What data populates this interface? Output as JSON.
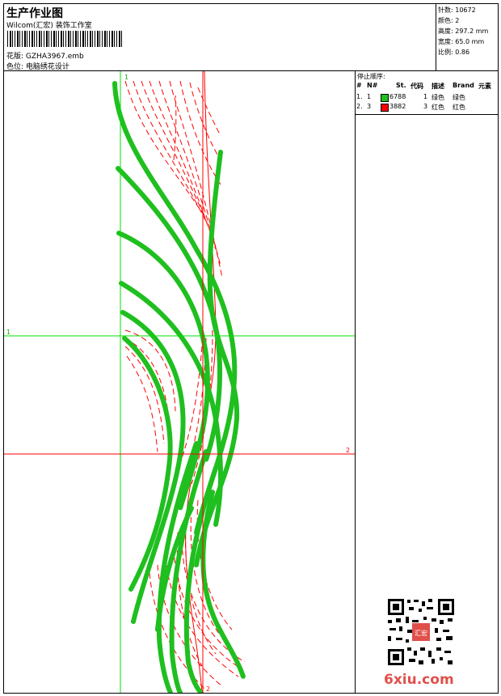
{
  "header": {
    "title": "生产作业图",
    "subtitle": "Wilcom(汇宏) 装饰工作室",
    "design_label": "花版:",
    "design_file": "GZHA3967.emb",
    "color_label": "色位:",
    "color_value": "电脑绣花设计"
  },
  "stats": [
    {
      "label": "针数:",
      "value": "10672"
    },
    {
      "label": "颜色:",
      "value": "2"
    },
    {
      "label": "高度:",
      "value": "297.2 mm"
    },
    {
      "label": "宽度:",
      "value": "65.0 mm"
    },
    {
      "label": "比例:",
      "value": "0.86"
    }
  ],
  "stop_sequence": {
    "title": "停止顺序:",
    "columns": [
      "#",
      "N#",
      "St.",
      "代码",
      "描述",
      "Brand",
      "元素"
    ],
    "rows": [
      {
        "num": "1.",
        "n": "1",
        "color": "#1fbf1f",
        "stitches": "6788",
        "code": "1",
        "desc": "绿色",
        "brand": "绿色"
      },
      {
        "num": "2.",
        "n": "3",
        "color": "#ff0000",
        "stitches": "3882",
        "code": "3",
        "desc": "红色",
        "brand": "红色"
      }
    ]
  },
  "guides": {
    "v1": "1",
    "h1": "1",
    "h2": "2",
    "v2": "2",
    "v1_color": "#00e000",
    "v2_color": "#ff0000"
  },
  "watermark": {
    "brand": "6xiu.com",
    "stamp": "汇宏"
  }
}
